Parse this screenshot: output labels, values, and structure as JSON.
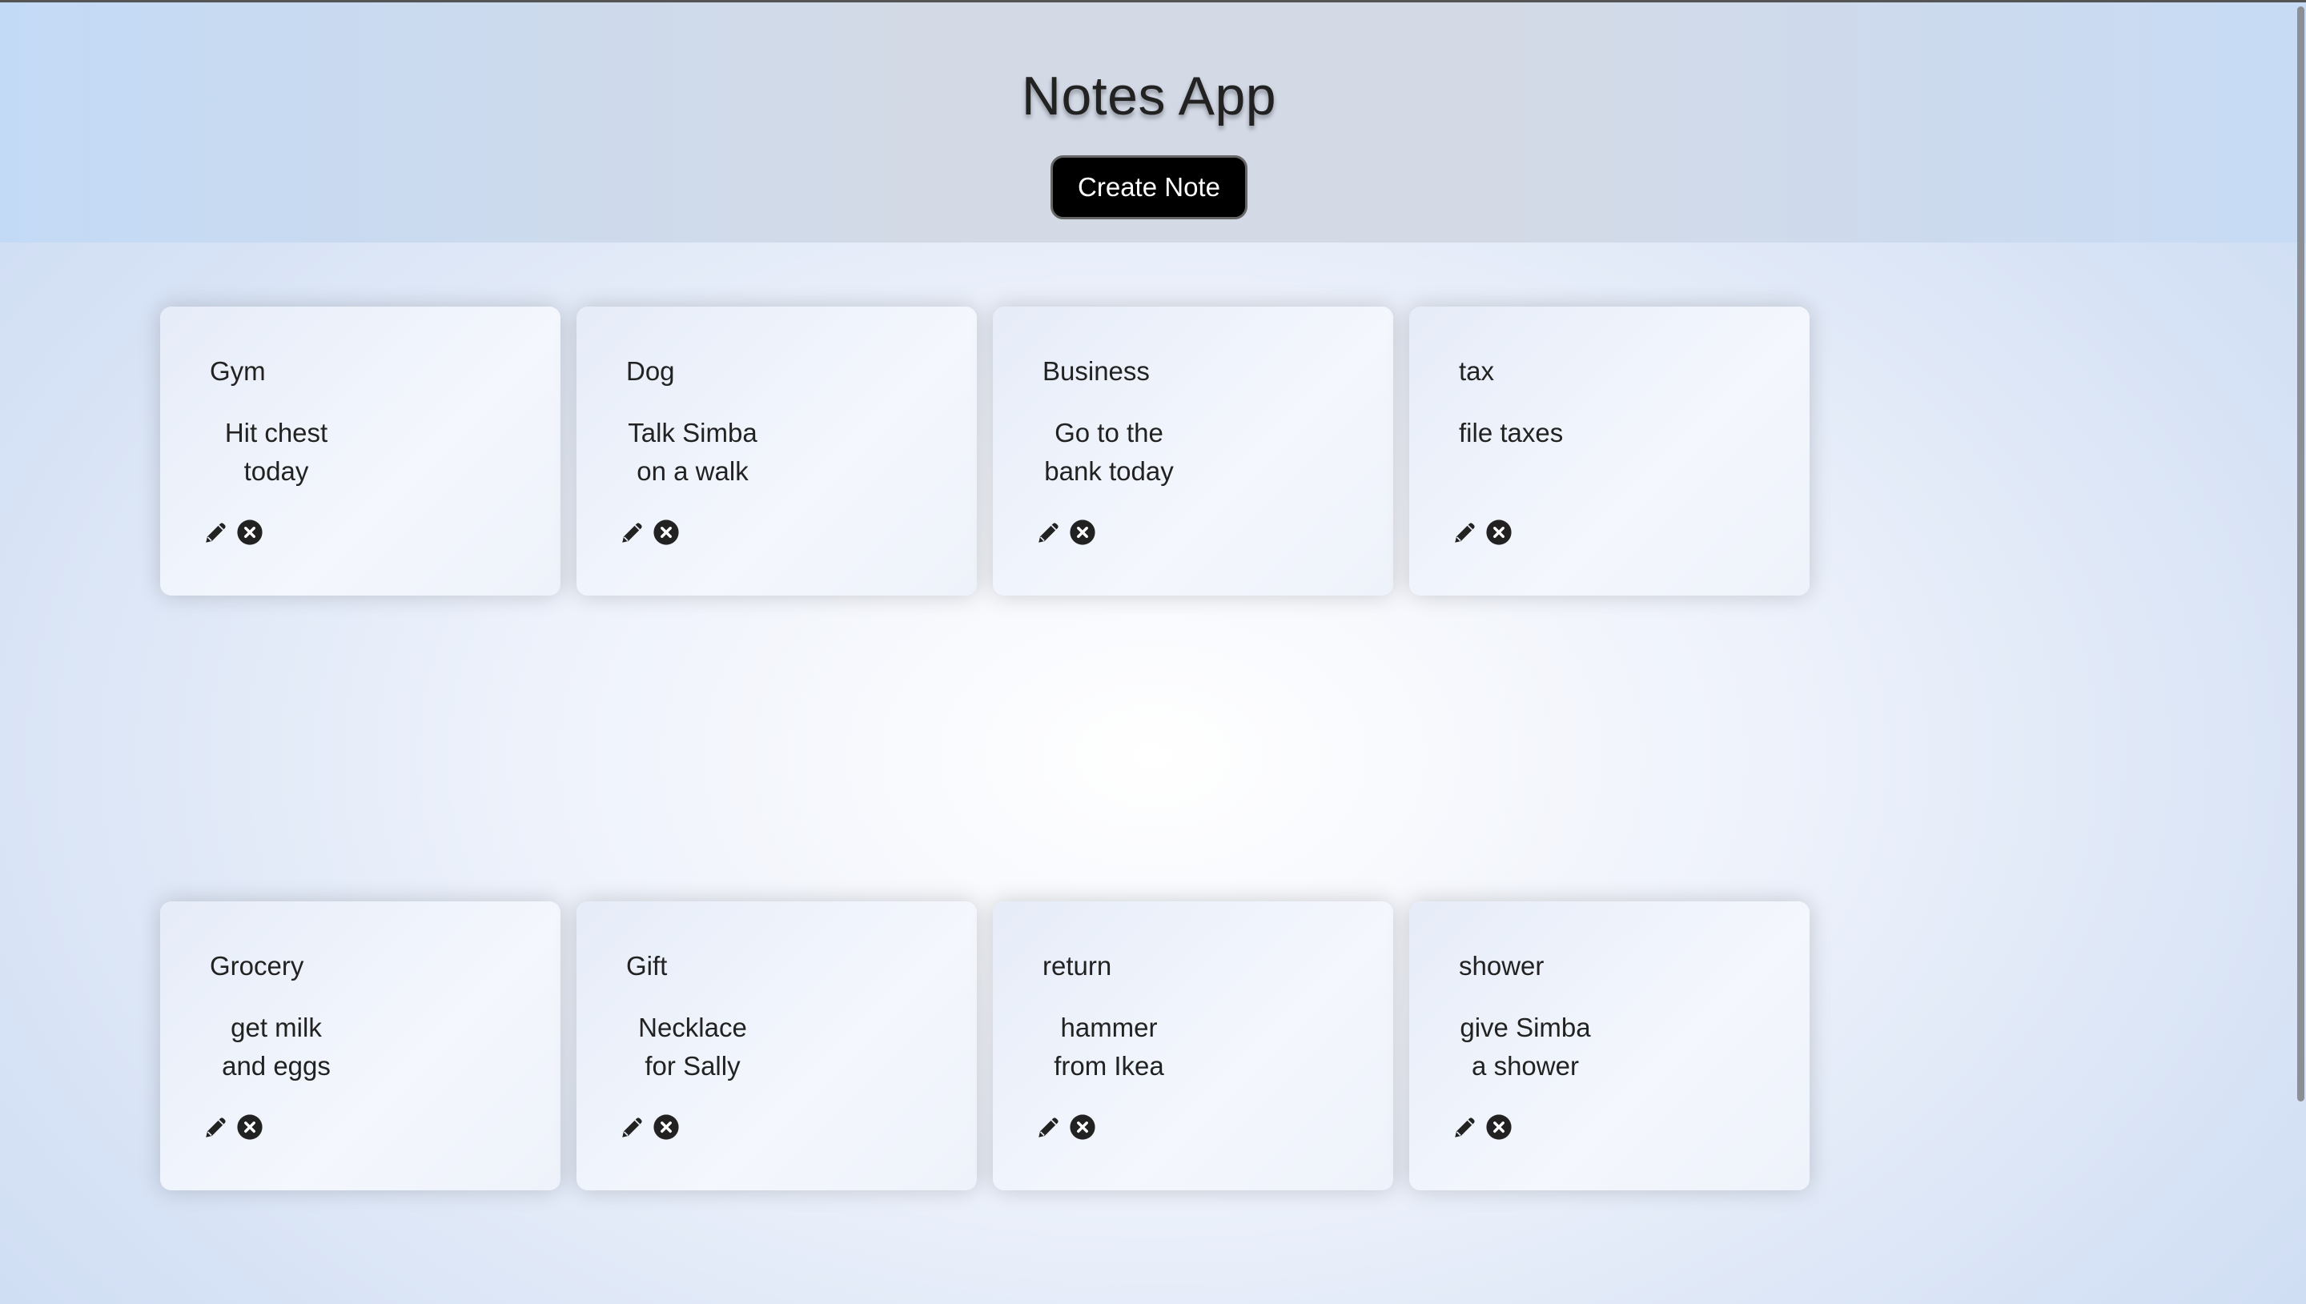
{
  "header": {
    "title": "Notes App",
    "create_button_label": "Create Note"
  },
  "icons": {
    "edit": "pencil-icon",
    "delete": "close-circle-icon"
  },
  "notes": [
    {
      "title": "Gym",
      "body": "Hit chest today",
      "line1": "Hit chest",
      "line2": "today",
      "centered": true
    },
    {
      "title": "Dog",
      "body": "Talk Simba on a walk",
      "line1": "Talk Simba",
      "line2": "on a walk",
      "centered": true
    },
    {
      "title": "Business",
      "body": "Go to the bank today",
      "line1": "Go to the",
      "line2": "bank today",
      "centered": true
    },
    {
      "title": "tax",
      "body": "file taxes",
      "line1": "file taxes",
      "line2": "",
      "centered": false
    },
    {
      "title": "Grocery",
      "body": "get milk and eggs",
      "line1": "get milk",
      "line2": "and eggs",
      "centered": true
    },
    {
      "title": "Gift",
      "body": "Necklace for Sally",
      "line1": "Necklace",
      "line2": "for Sally",
      "centered": true
    },
    {
      "title": "return",
      "body": "hammer from Ikea",
      "line1": "hammer",
      "line2": "from Ikea",
      "centered": true
    },
    {
      "title": "shower",
      "body": "give Simba a shower",
      "line1": "give Simba",
      "line2": "a shower",
      "centered": true
    }
  ]
}
